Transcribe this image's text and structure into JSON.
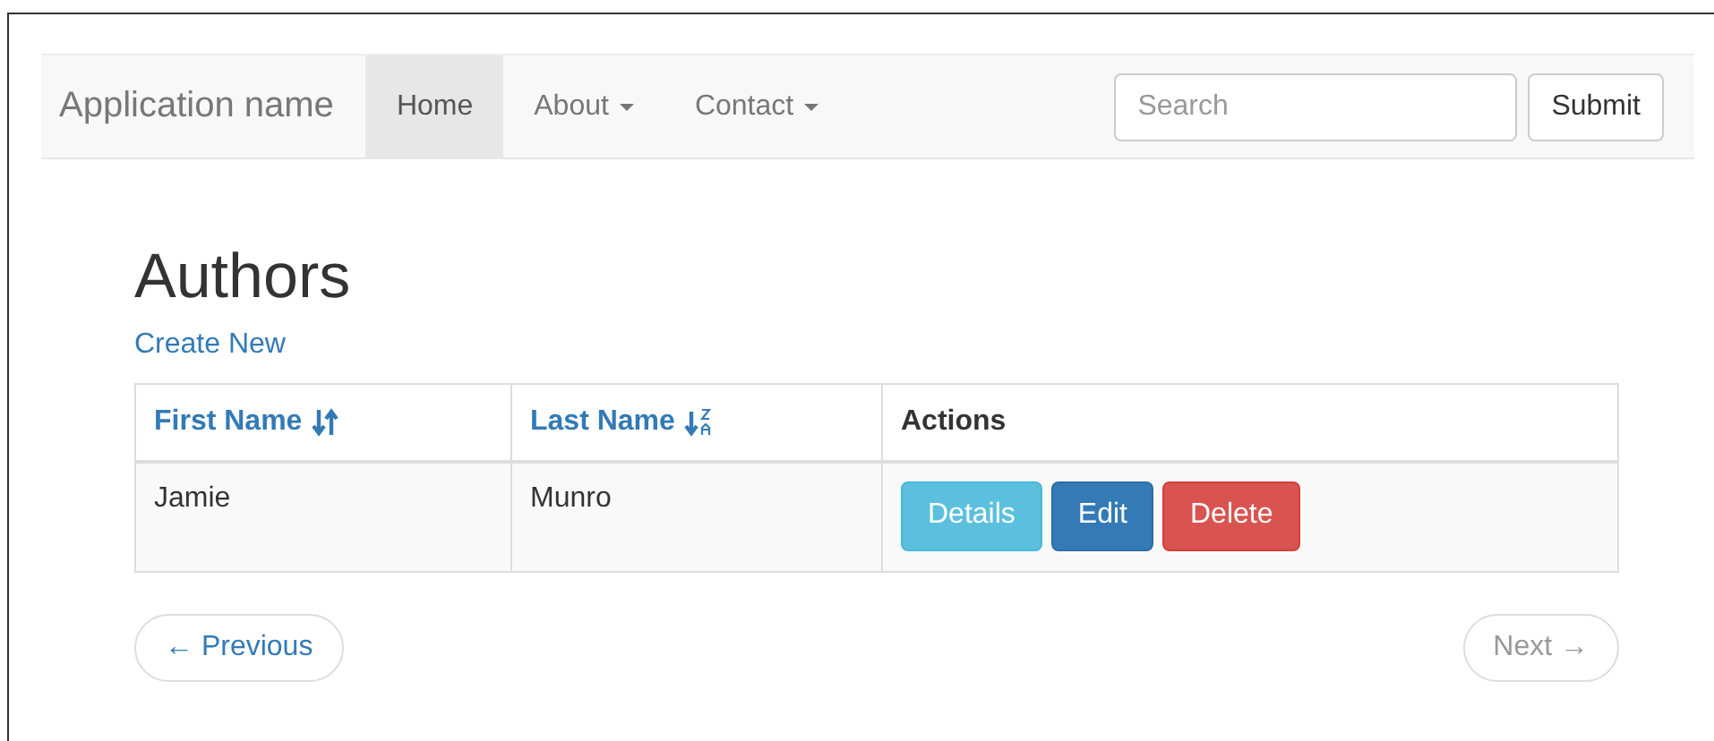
{
  "navbar": {
    "brand": "Application name",
    "items": [
      {
        "label": "Home",
        "selected": true,
        "dropdown": false
      },
      {
        "label": "About",
        "selected": false,
        "dropdown": true
      },
      {
        "label": "Contact",
        "selected": false,
        "dropdown": true
      }
    ],
    "search": {
      "placeholder": "Search"
    },
    "submit": "Submit"
  },
  "page": {
    "title": "Authors",
    "create_link": "Create New"
  },
  "table": {
    "columns": [
      {
        "label": "First Name",
        "kind": "sort-both"
      },
      {
        "label": "Last Name",
        "kind": "sort-alpha"
      },
      {
        "label": "Actions",
        "kind": "plain"
      }
    ],
    "rows": [
      {
        "first": "Jamie",
        "last": "Munro",
        "actions": [
          {
            "label": "Details",
            "kind": "info"
          },
          {
            "label": "Edit",
            "kind": "primary"
          },
          {
            "label": "Delete",
            "kind": "danger"
          }
        ]
      }
    ]
  },
  "pager": {
    "previous": {
      "label": "← Previous",
      "disabled": false
    },
    "next": {
      "label": "Next →",
      "disabled": true
    }
  }
}
